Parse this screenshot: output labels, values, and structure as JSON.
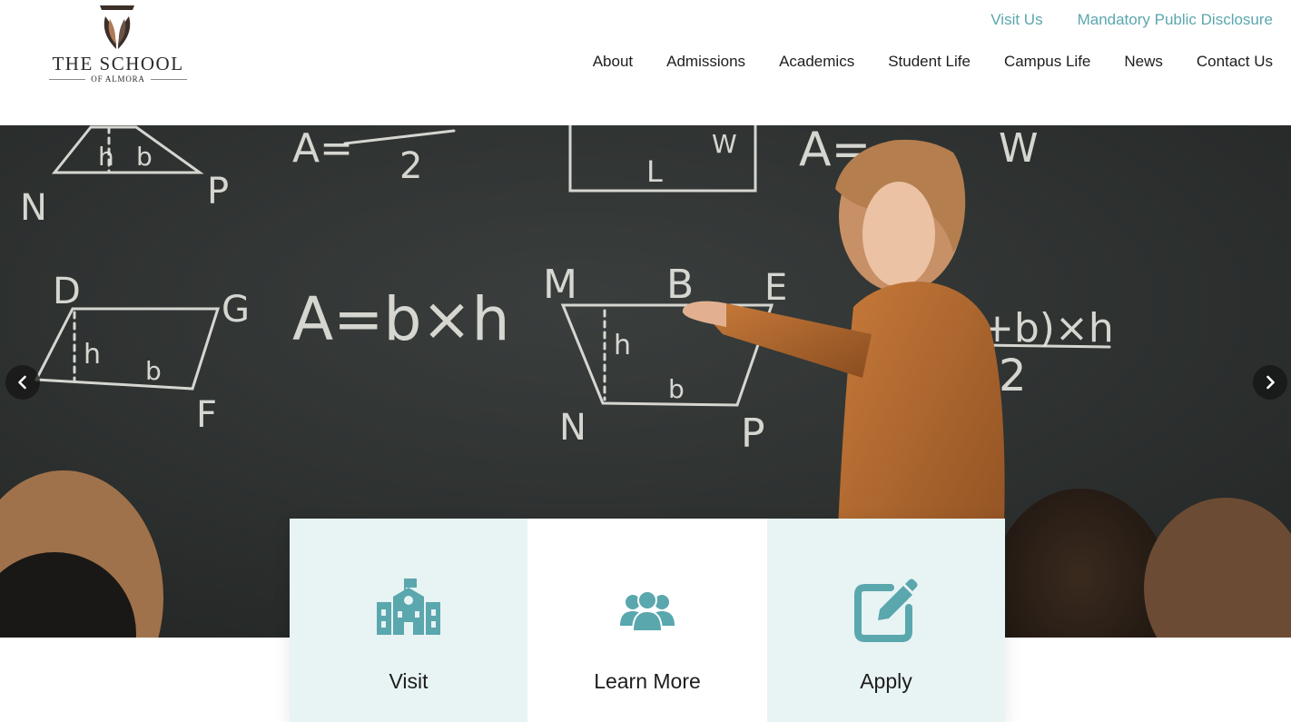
{
  "brand": {
    "name": "THE SCHOOL",
    "subname": "OF ALMORA"
  },
  "utility_nav": [
    {
      "label": "Visit Us"
    },
    {
      "label": "Mandatory Public Disclosure"
    }
  ],
  "main_nav": [
    {
      "label": "About"
    },
    {
      "label": "Admissions"
    },
    {
      "label": "Academics"
    },
    {
      "label": "Student Life"
    },
    {
      "label": "Campus Life"
    },
    {
      "label": "News"
    },
    {
      "label": "Contact Us"
    }
  ],
  "hero": {
    "image": "classroom-chalkboard-boy-pointing",
    "chalk_text": [
      "A = b×h",
      "A = (a+b)×h / 2",
      "M",
      "B",
      "E",
      "N",
      "P",
      "D",
      "G",
      "F",
      "h",
      "b",
      "L",
      "W"
    ]
  },
  "carousel": {
    "prev_icon": "chevron-left-icon",
    "next_icon": "chevron-right-icon"
  },
  "cards": [
    {
      "label": "Visit",
      "icon": "school-building-icon"
    },
    {
      "label": "Learn More",
      "icon": "people-group-icon"
    },
    {
      "label": "Apply",
      "icon": "edit-form-icon"
    }
  ],
  "colors": {
    "accent": "#5aa7ae",
    "card_tint": "#e8f3f4",
    "text": "#1d1d1d",
    "chalkboard": "#2d3130"
  }
}
